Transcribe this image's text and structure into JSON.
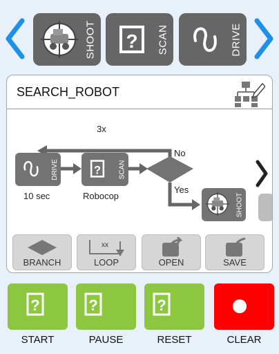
{
  "palette": {
    "commands": [
      {
        "id": "shoot",
        "label": "SHOOT",
        "icon": "crosshair-robot-icon"
      },
      {
        "id": "scan",
        "label": "SCAN",
        "icon": "unknown-block-icon"
      },
      {
        "id": "drive",
        "label": "DRIVE",
        "icon": "squiggle-icon"
      }
    ],
    "prev_icon": "chevron-left-icon",
    "next_icon": "chevron-right-icon"
  },
  "program": {
    "title": "SEARCH_ROBOT",
    "flowchart_icon": "flowchart-edit-icon",
    "loop_count": "3x",
    "branch_no": "No",
    "branch_yes": "Yes",
    "blocks": [
      {
        "label": "DRIVE",
        "caption": "10 sec"
      },
      {
        "label": "SCAN",
        "caption": "Robocop"
      },
      {
        "label": "SHOOT",
        "caption": ""
      }
    ]
  },
  "tools": [
    {
      "label": "BRANCH",
      "icon": "diamond-icon"
    },
    {
      "label": "LOOP",
      "icon": "loop-arrow-icon",
      "badge": "xx"
    },
    {
      "label": "OPEN",
      "icon": "tablet-open-icon"
    },
    {
      "label": "SAVE",
      "icon": "tablet-save-icon"
    }
  ],
  "controls": [
    {
      "label": "START",
      "icon": "unknown-block-icon",
      "color": "#8dc63f"
    },
    {
      "label": "PAUSE",
      "icon": "unknown-block-icon",
      "color": "#8dc63f"
    },
    {
      "label": "RESET",
      "icon": "unknown-block-icon",
      "color": "#8dc63f"
    },
    {
      "label": "CLEAR",
      "icon": "record-dot-icon",
      "color": "#ff0000"
    }
  ],
  "colors": {
    "accent_blue": "#1e90e6",
    "tile_gray": "#666666",
    "green": "#8dc63f",
    "red": "#ff0000"
  }
}
